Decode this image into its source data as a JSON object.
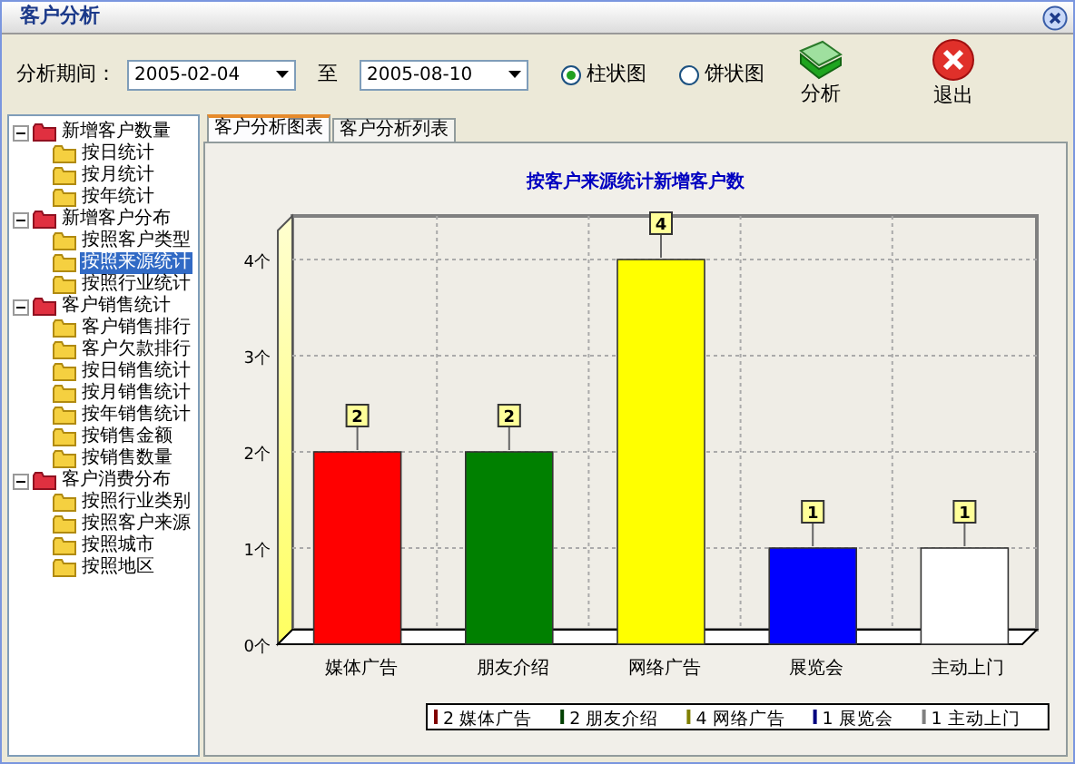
{
  "window": {
    "title": "客户分析"
  },
  "toolbar": {
    "period_label": "分析期间：",
    "start_date": "2005-02-04",
    "to_label": "至",
    "end_date": "2005-08-10",
    "chart_types": [
      {
        "label": "柱状图",
        "selected": true
      },
      {
        "label": "饼状图",
        "selected": false
      }
    ],
    "buttons": [
      {
        "label": "分析",
        "kind": "analyze"
      },
      {
        "label": "退出",
        "kind": "exit"
      }
    ]
  },
  "tree": [
    {
      "label": "新增客户数量",
      "expanded": true,
      "selected": false,
      "children": [
        {
          "label": "按日统计",
          "selected": false
        },
        {
          "label": "按月统计",
          "selected": false
        },
        {
          "label": "按年统计",
          "selected": false
        }
      ]
    },
    {
      "label": "新增客户分布",
      "expanded": true,
      "selected": false,
      "children": [
        {
          "label": "按照客户类型",
          "selected": false
        },
        {
          "label": "按照来源统计",
          "selected": true
        },
        {
          "label": "按照行业统计",
          "selected": false
        }
      ]
    },
    {
      "label": "客户销售统计",
      "expanded": true,
      "selected": false,
      "children": [
        {
          "label": "客户销售排行",
          "selected": false
        },
        {
          "label": "客户欠款排行",
          "selected": false
        },
        {
          "label": "按日销售统计",
          "selected": false
        },
        {
          "label": "按月销售统计",
          "selected": false
        },
        {
          "label": "按年销售统计",
          "selected": false
        },
        {
          "label": "按销售金额",
          "selected": false
        },
        {
          "label": "按销售数量",
          "selected": false
        }
      ]
    },
    {
      "label": "客户消费分布",
      "expanded": true,
      "selected": false,
      "children": [
        {
          "label": "按照行业类别",
          "selected": false
        },
        {
          "label": "按照客户来源",
          "selected": false
        },
        {
          "label": "按照城市",
          "selected": false
        },
        {
          "label": "按照地区",
          "selected": false
        }
      ]
    }
  ],
  "tabs": [
    {
      "label": "客户分析图表",
      "selected": true
    },
    {
      "label": "客户分析列表",
      "selected": false
    }
  ],
  "chart_data": {
    "type": "bar",
    "title": "按客户来源统计新增客户数",
    "categories": [
      "媒体广告",
      "朋友介绍",
      "网络广告",
      "展览会",
      "主动上门"
    ],
    "values": [
      2,
      2,
      4,
      1,
      1
    ],
    "colors": [
      "#ff0000",
      "#008000",
      "#ffff00",
      "#0000ff",
      "#ffffff"
    ],
    "ylim": [
      0,
      4
    ],
    "yticks": [
      {
        "value": 0,
        "label": "0个"
      },
      {
        "value": 1,
        "label": "1个"
      },
      {
        "value": 2,
        "label": "2个"
      },
      {
        "value": 3,
        "label": "3个"
      },
      {
        "value": 4,
        "label": "4个"
      }
    ],
    "data_labels": true,
    "grid": true
  },
  "legend": [
    {
      "label": "2 媒体广告",
      "color": "#800000"
    },
    {
      "label": "2 朋友介绍",
      "color": "#004000"
    },
    {
      "label": "4 网络广告",
      "color": "#808000"
    },
    {
      "label": "1 展览会",
      "color": "#000080"
    },
    {
      "label": "1 主动上门",
      "color": "#808080"
    }
  ]
}
